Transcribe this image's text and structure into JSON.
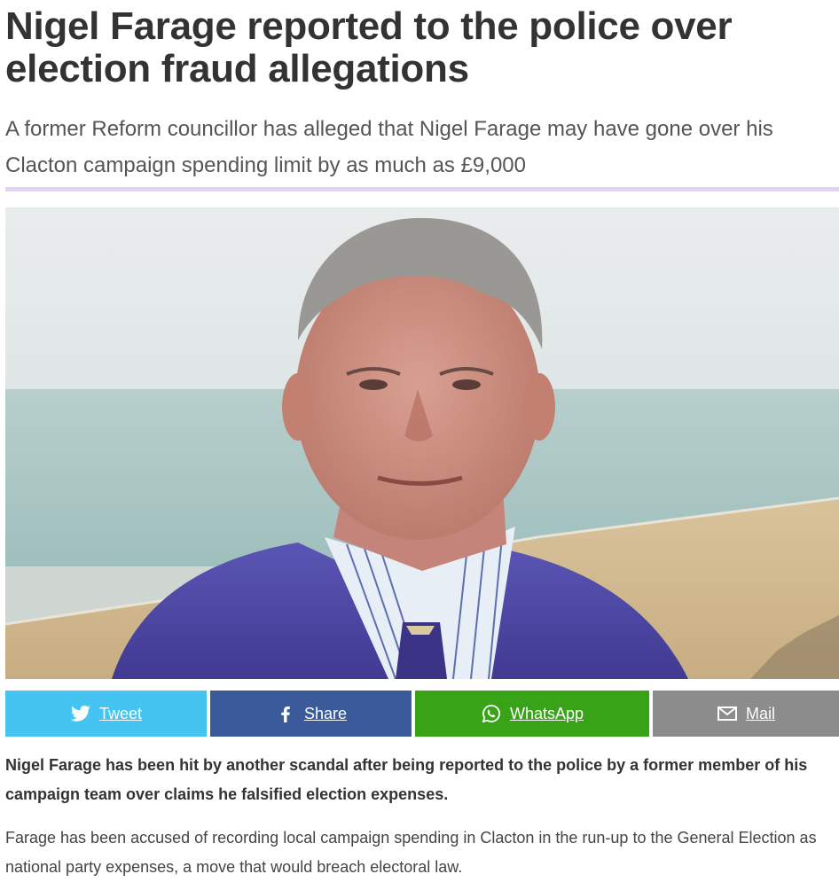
{
  "article": {
    "headline": "Nigel Farage reported to the police over election fraud allegations",
    "standfirst": "A former Reform councillor has alleged that Nigel Farage may have gone over his Clacton campaign spending limit by as much as £9,000",
    "lead_paragraph": "Nigel Farage has been hit by another scandal after being reported to the police by a former member of his campaign team over claims he falsified election expenses.",
    "body_paragraph": "Farage has been accused of recording local campaign spending in Clacton in the run-up to the General Election as national party expenses, a move that would breach electoral law."
  },
  "share": {
    "twitter_label": "Tweet",
    "facebook_label": "Share",
    "whatsapp_label": "WhatsApp",
    "mail_label": "Mail",
    "twitter_icon": "twitter-bird-icon",
    "facebook_icon": "facebook-f-icon",
    "whatsapp_icon": "whatsapp-icon",
    "mail_icon": "envelope-icon"
  },
  "colors": {
    "divider": "#e2d2f4",
    "twitter": "#45c3f1",
    "facebook": "#3a5a99",
    "whatsapp": "#38a316",
    "mail": "#8c8c8c"
  }
}
